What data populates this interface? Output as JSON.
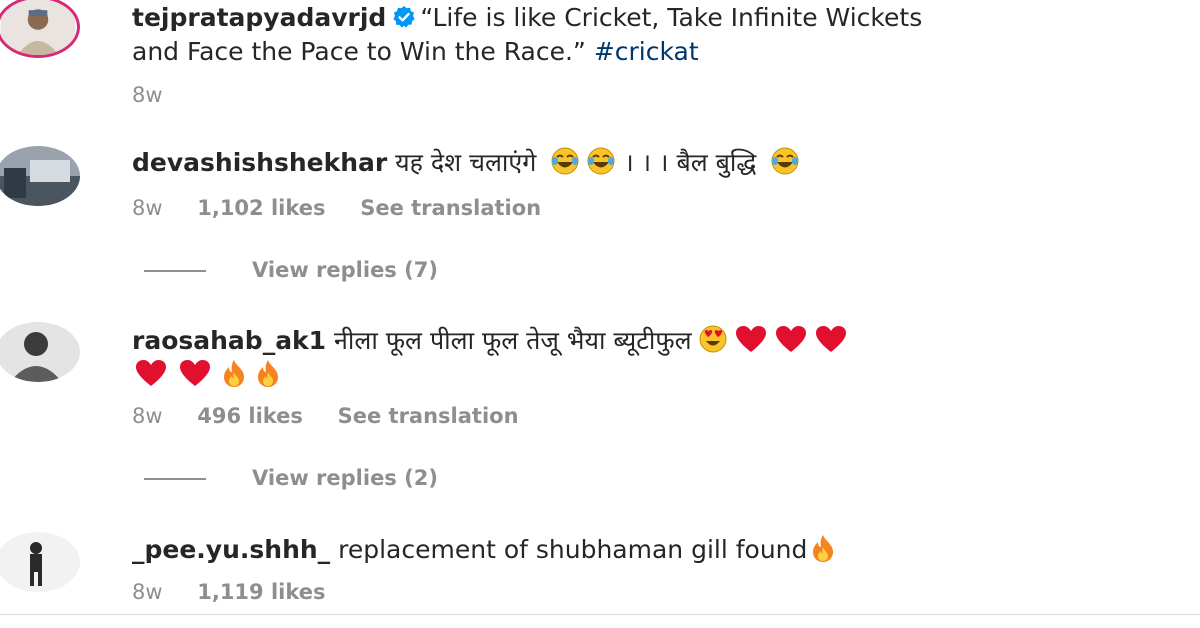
{
  "post": {
    "username": "tejpratapyadavrjd",
    "caption_line1": "“Life is like Cricket, Take Infinite Wickets",
    "caption_line2": "and Face the Pace to Win the Race.” ",
    "hashtag": "#crickat",
    "time": "8w",
    "verified_icon": "verified-badge-icon"
  },
  "comments": [
    {
      "username": "devashishshekhar",
      "text": "यह देश चलाएंगे",
      "text2": "। । । बैल बुद्धि",
      "time": "8w",
      "likes": "1,102 likes",
      "translation": "See translation",
      "view_replies": "View replies (7)",
      "emojis": [
        "laughing-crying-emoji",
        "laughing-crying-emoji",
        "laughing-crying-emoji"
      ]
    },
    {
      "username": "raosahab_ak1",
      "text": "नीला फूल पीला फूल तेजू भैया ब्यूटीफुल",
      "time": "8w",
      "likes": "496 likes",
      "translation": "See translation",
      "view_replies": "View replies (2)",
      "emojis": [
        "heart-eyes-emoji",
        "red-heart-emoji",
        "red-heart-emoji",
        "red-heart-emoji",
        "red-heart-emoji",
        "red-heart-emoji",
        "fire-emoji",
        "fire-emoji"
      ]
    },
    {
      "username": "_pee.yu.shhh_",
      "text": "replacement of shubhaman gill found",
      "time": "8w",
      "likes": "1,119 likes",
      "emojis": [
        "fire-emoji"
      ]
    }
  ],
  "colors": {
    "text": "#262626",
    "meta": "#8e8e8e",
    "hashtag": "#00376b",
    "verified": "#0095f6",
    "heart": "#e0102e",
    "emoji_yellow": "#f7c52b"
  }
}
